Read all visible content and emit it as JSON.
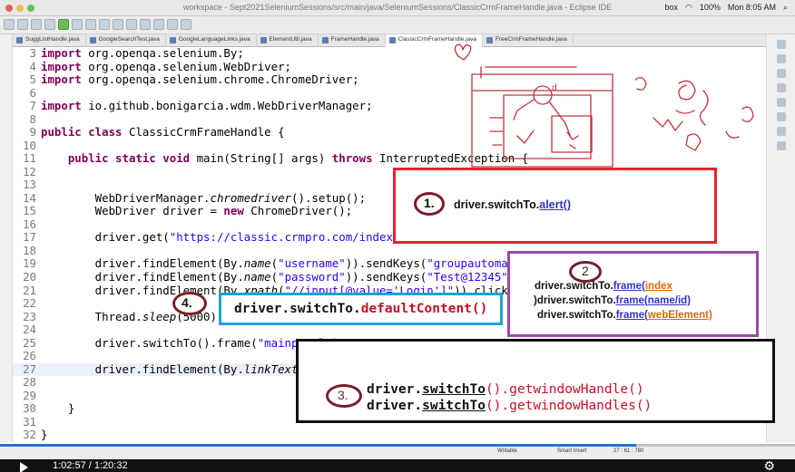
{
  "window": {
    "title": "workspace - Sept2021SeleniumSessions/src/main/java/SeleniumSessions/ClassicCrmFrameHandle.java - Eclipse IDE"
  },
  "menubar": {
    "tray_box": "box",
    "battery": "100%",
    "clock": "Mon 8:05 AM"
  },
  "tabs": [
    {
      "label": "SuggListHandle.java"
    },
    {
      "label": "GoogleSearchTest.java"
    },
    {
      "label": "GoogleLanguageLinks.java"
    },
    {
      "label": "ElementUtil.java"
    },
    {
      "label": "FrameHandle.java"
    },
    {
      "label": "ClassicCrmFrameHandle.java",
      "active": true
    },
    {
      "label": "FreeCrmFrameHandle.java"
    }
  ],
  "code_lines": [
    {
      "n": "3",
      "html": "<span class=\"k\">import</span> org.openqa.selenium.By;"
    },
    {
      "n": "4",
      "html": "<span class=\"k\">import</span> org.openqa.selenium.WebDriver;"
    },
    {
      "n": "5",
      "html": "<span class=\"k\">import</span> org.openqa.selenium.chrome.ChromeDriver;"
    },
    {
      "n": "6",
      "html": ""
    },
    {
      "n": "7",
      "html": "<span class=\"k\">import</span> io.github.bonigarcia.wdm.WebDriverManager;"
    },
    {
      "n": "8",
      "html": ""
    },
    {
      "n": "9",
      "html": "<span class=\"k\">public class</span> ClassicCrmFrameHandle {"
    },
    {
      "n": "10",
      "html": ""
    },
    {
      "n": "11",
      "html": "    <span class=\"k\">public static void</span> main(String[] args) <span class=\"k\">throws</span> InterruptedException {"
    },
    {
      "n": "12",
      "html": ""
    },
    {
      "n": "13",
      "html": ""
    },
    {
      "n": "14",
      "html": "        WebDriverManager.<span class=\"i\">chromedriver</span>().setup();"
    },
    {
      "n": "15",
      "html": "        WebDriver driver = <span class=\"k\">new</span> ChromeDriver();"
    },
    {
      "n": "16",
      "html": ""
    },
    {
      "n": "17",
      "html": "        driver.get(<span class=\"s\">\"https://classic.crmpro.com/index.html\"</span>);"
    },
    {
      "n": "18",
      "html": ""
    },
    {
      "n": "19",
      "html": "        driver.findElement(By.<span class=\"i\">name</span>(<span class=\"s\">\"username\"</span>)).sendKeys(<span class=\"s\">\"groupautomation\"</span>);"
    },
    {
      "n": "20",
      "html": "        driver.findElement(By.<span class=\"i\">name</span>(<span class=\"s\">\"password\"</span>)).sendKeys(<span class=\"s\">\"Test@12345\"</span>);"
    },
    {
      "n": "21",
      "html": "        driver.findElement(By.<span class=\"i\">xpath</span>(<span class=\"s\">\"//input[@value='Login']\"</span>)).click();"
    },
    {
      "n": "22",
      "html": ""
    },
    {
      "n": "23",
      "html": "        Thread.<span class=\"i\">sleep</span>(5000);"
    },
    {
      "n": "24",
      "html": ""
    },
    {
      "n": "25",
      "html": "        driver.switchTo().frame(<span class=\"s\">\"mainpanel\"</span>);"
    },
    {
      "n": "26",
      "html": ""
    },
    {
      "n": "27",
      "html": "        driver.findElement(By.<span class=\"i\">linkText</span>(<span class=\"s\">\"CONTACTS\"</span>)).click();",
      "highlight": true
    },
    {
      "n": "28",
      "html": ""
    },
    {
      "n": "29",
      "html": ""
    },
    {
      "n": "30",
      "html": "    }"
    },
    {
      "n": "31",
      "html": ""
    },
    {
      "n": "32",
      "html": "}"
    }
  ],
  "annotations": {
    "a1": {
      "num": "1.",
      "prefix": "driver.switchTo.",
      "method": "alert()"
    },
    "a2": {
      "num": "2",
      "l1_prefix": "driver.switchTo.",
      "l1_method": "frame(",
      "l1_arg": "index",
      "l2_paren": ")",
      "l2_prefix": "driver.switchTo.",
      "l2_method": "frame(",
      "l2_arg": "name/id)",
      "l3_prefix": "driver.switchTo.",
      "l3_method": "frame(",
      "l3_arg": "webElement)"
    },
    "a3": {
      "num": "3.",
      "l1_pre": "driver.",
      "l1_sw": "switchTo",
      "l1_post": "().getwindowHandle()",
      "l2_pre": "driver.",
      "l2_sw": "switchTo",
      "l2_post": "().getwindowHandles()"
    },
    "a4": {
      "num": "4.",
      "pre": "driver.switchTo.",
      "method": "defaultContent()"
    }
  },
  "status": {
    "writable": "Writable",
    "insert": "Smart Insert",
    "position": "27 : 61 : 780"
  },
  "player": {
    "time": "1:02:57 / 1:20:32",
    "progress": 0.8
  },
  "colors": {
    "red": "#e8212c",
    "purple": "#9b49a8",
    "blue": "#1aa3d8",
    "black": "#111111",
    "marker": "#7a1d2a"
  }
}
